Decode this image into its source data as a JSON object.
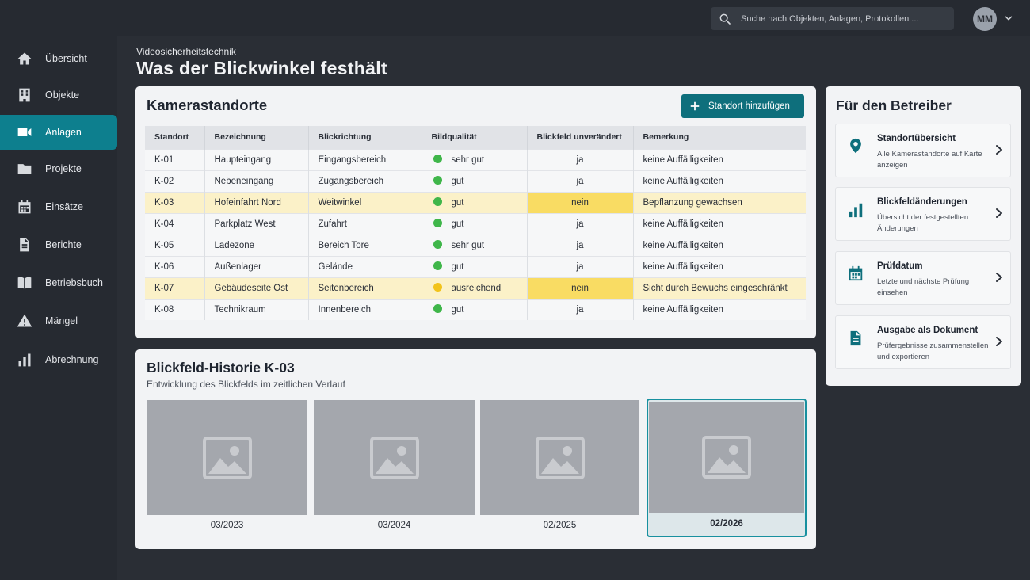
{
  "header": {
    "search_placeholder": "Suche nach Objekten, Anlagen, Protokollen ...",
    "avatar_initials": "MM"
  },
  "sidebar": {
    "items": [
      {
        "label": "Übersicht",
        "icon": "home-icon"
      },
      {
        "label": "Objekte",
        "icon": "building-icon"
      },
      {
        "label": "Anlagen",
        "icon": "camera-icon",
        "active": true
      },
      {
        "label": "Projekte",
        "icon": "folder-icon"
      },
      {
        "label": "Einsätze",
        "icon": "calendar-icon"
      },
      {
        "label": "Berichte",
        "icon": "document-icon"
      },
      {
        "label": "Betriebsbuch",
        "icon": "book-icon"
      },
      {
        "label": "Mängel",
        "icon": "warning-icon"
      },
      {
        "label": "Abrechnung",
        "icon": "bar-chart-icon"
      }
    ]
  },
  "page": {
    "eyebrow": "Videosicherheitstechnik",
    "title": "Was der Blickwinkel festhält"
  },
  "cameras": {
    "title": "Kamerastandorte",
    "add_button": "Standort hinzufügen",
    "columns": [
      "Standort",
      "Bezeichnung",
      "Blickrichtung",
      "Bildqualität",
      "Blickfeld unverändert",
      "Bemerkung"
    ],
    "rows": [
      {
        "id": "K-01",
        "name": "Haupteingang",
        "direction": "Eingangsbereich",
        "quality": "sehr gut",
        "unchanged": "ja",
        "remark": "keine Auffälligkeiten"
      },
      {
        "id": "K-02",
        "name": "Nebeneingang",
        "direction": "Zugangsbereich",
        "quality": "gut",
        "unchanged": "ja",
        "remark": "keine Auffälligkeiten"
      },
      {
        "id": "K-03",
        "name": "Hofeinfahrt Nord",
        "direction": "Weitwinkel",
        "quality": "gut",
        "unchanged": "nein",
        "remark": "Bepflanzung gewachsen"
      },
      {
        "id": "K-04",
        "name": "Parkplatz West",
        "direction": "Zufahrt",
        "quality": "gut",
        "unchanged": "ja",
        "remark": "keine Auffälligkeiten"
      },
      {
        "id": "K-05",
        "name": "Ladezone",
        "direction": "Bereich Tore",
        "quality": "sehr gut",
        "unchanged": "ja",
        "remark": "keine Auffälligkeiten"
      },
      {
        "id": "K-06",
        "name": "Außenlager",
        "direction": "Gelände",
        "quality": "gut",
        "unchanged": "ja",
        "remark": "keine Auffälligkeiten"
      },
      {
        "id": "K-07",
        "name": "Gebäudeseite Ost",
        "direction": "Seitenbereich",
        "quality": "ausreichend",
        "unchanged": "nein",
        "remark": "Sicht durch Bewuchs eingeschränkt"
      },
      {
        "id": "K-08",
        "name": "Technikraum",
        "direction": "Innenbereich",
        "quality": "gut",
        "unchanged": "ja",
        "remark": "keine Auffälligkeiten"
      }
    ]
  },
  "history": {
    "title": "Blickfeld-Historie K-03",
    "subtitle": "Entwicklung des Blickfelds im zeitlichen Verlauf",
    "snapshots": [
      {
        "label": "03/2023"
      },
      {
        "label": "03/2024"
      },
      {
        "label": "02/2025"
      },
      {
        "label": "02/2026",
        "selected": true
      }
    ]
  },
  "operator": {
    "title": "Für den Betreiber",
    "items": [
      {
        "title": "Standortübersicht",
        "desc": "Alle Kamerastandorte auf Karte anzeigen",
        "icon": "map-pin-icon"
      },
      {
        "title": "Blickfeldänderungen",
        "desc": "Übersicht der festgestellten Änderungen",
        "icon": "bar-chart-icon"
      },
      {
        "title": "Prüfdatum",
        "desc": "Letzte und nächste Prüfung einsehen",
        "icon": "calendar-icon"
      },
      {
        "title": "Ausgabe als Dokument",
        "desc": "Prüfergebnisse zusammenstellen und exportieren",
        "icon": "document-icon"
      }
    ]
  },
  "colors": {
    "accent": "#0e6f7c",
    "sidebar_active": "#0d7f8e",
    "status_good": "#3fb64a",
    "status_warn": "#f2c31b",
    "row_highlight": "#fbf1c8",
    "cell_highlight": "#f9dc63"
  }
}
